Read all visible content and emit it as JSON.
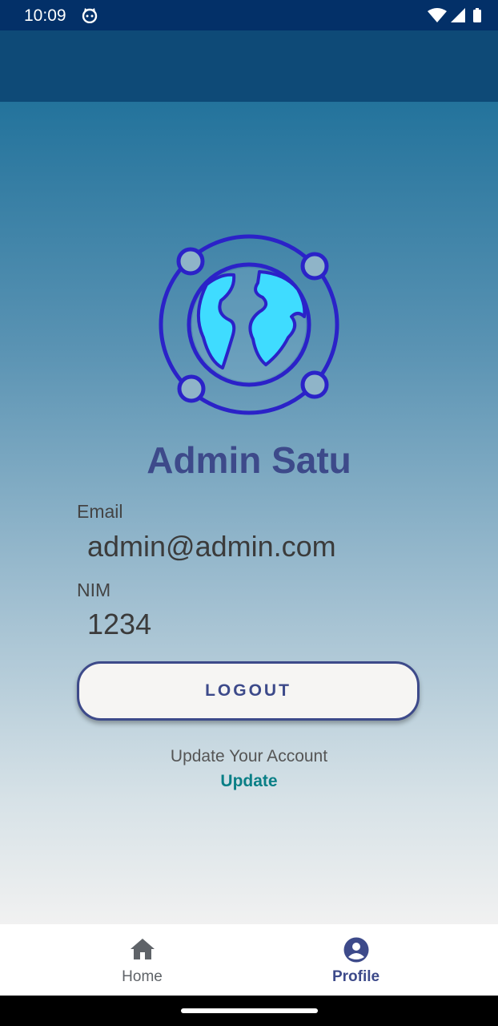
{
  "status_bar": {
    "time": "10:09",
    "icons": [
      "cat-icon",
      "wifi-icon",
      "signal-icon",
      "battery-icon"
    ]
  },
  "profile": {
    "name": "Admin Satu",
    "email_label": "Email",
    "email_value": "admin@admin.com",
    "nim_label": "NIM",
    "nim_value": "1234"
  },
  "actions": {
    "logout_label": "LOGOUT",
    "update_prompt": "Update Your Account",
    "update_link": "Update"
  },
  "bottom_nav": {
    "items": [
      {
        "label": "Home",
        "icon": "home-icon",
        "active": false
      },
      {
        "label": "Profile",
        "icon": "account-circle-icon",
        "active": true
      }
    ]
  },
  "colors": {
    "status_bar": "#033068",
    "app_bar": "#0e4a77",
    "accent": "#3d4a8a",
    "link": "#0a7f86",
    "logo_stroke": "#2b22c8",
    "logo_fill": "#3fdcff"
  }
}
